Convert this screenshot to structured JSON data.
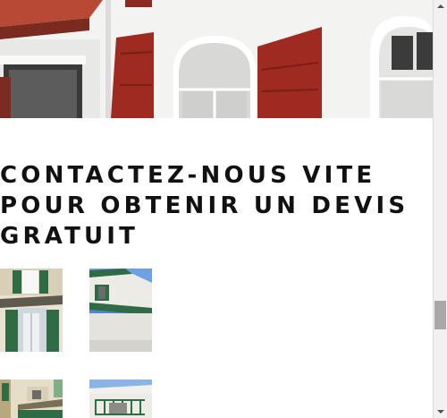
{
  "contact": {
    "heading": "CONTACTEZ-NOUS VITE POUR OBTENIR UN DEVIS GRATUIT"
  },
  "colors": {
    "shutter_red": "#9e2a22",
    "wall_white": "#f4f4f2",
    "shutter_green": "#2f6b45",
    "sky_blue": "#4a86d6"
  },
  "icons": {
    "scroll_up": "triangle-up",
    "scroll_down": "triangle-down"
  }
}
